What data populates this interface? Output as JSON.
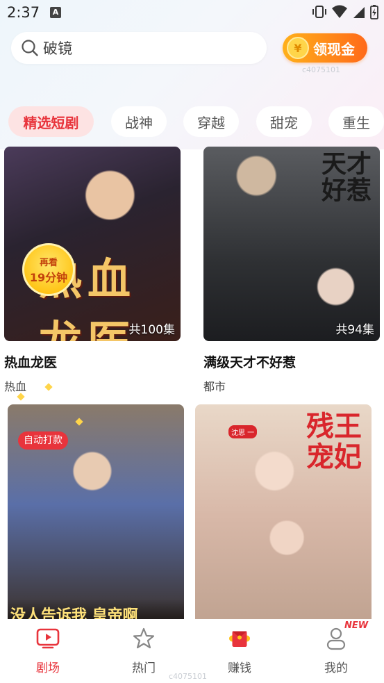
{
  "status_bar": {
    "time": "2:37",
    "notification_letter": "A"
  },
  "search": {
    "text": "破镜"
  },
  "cash_button": {
    "label": "领现金",
    "coin_symbol": "¥"
  },
  "watermark": "c4075101",
  "watermark_bottom": "c4075101",
  "tabs": [
    {
      "label": "精选短剧",
      "active": true
    },
    {
      "label": "战神",
      "active": false
    },
    {
      "label": "穿越",
      "active": false
    },
    {
      "label": "甜宠",
      "active": false
    },
    {
      "label": "重生",
      "active": false
    }
  ],
  "dramas": [
    {
      "title": "热血龙医",
      "genre": "热血",
      "episodes": "共100集",
      "poster_text": "热血龙医"
    },
    {
      "title": "满级天才不好惹",
      "genre": "都市",
      "episodes": "共94集",
      "poster_text": "天才好惹"
    },
    {
      "title": "",
      "genre": "",
      "episodes": "",
      "poster_text": "没人告诉我 皇帝啊"
    },
    {
      "title": "",
      "genre": "",
      "episodes": "",
      "poster_text": "残王宠妃",
      "poster_tag": "沈思 一"
    }
  ],
  "rewatch_badge": {
    "line1": "再看",
    "line2": "19分钟",
    "autopay": "自动打款"
  },
  "bottom_nav": {
    "items": [
      {
        "label": "剧场",
        "active": true
      },
      {
        "label": "热门",
        "active": false
      },
      {
        "label": "赚钱",
        "active": false
      },
      {
        "label": "我的",
        "active": false
      }
    ],
    "new_badge": "NEW"
  },
  "colors": {
    "accent": "#e8343c",
    "cash_gradient_start": "#ffb01a",
    "cash_gradient_end": "#ff6a1a"
  }
}
